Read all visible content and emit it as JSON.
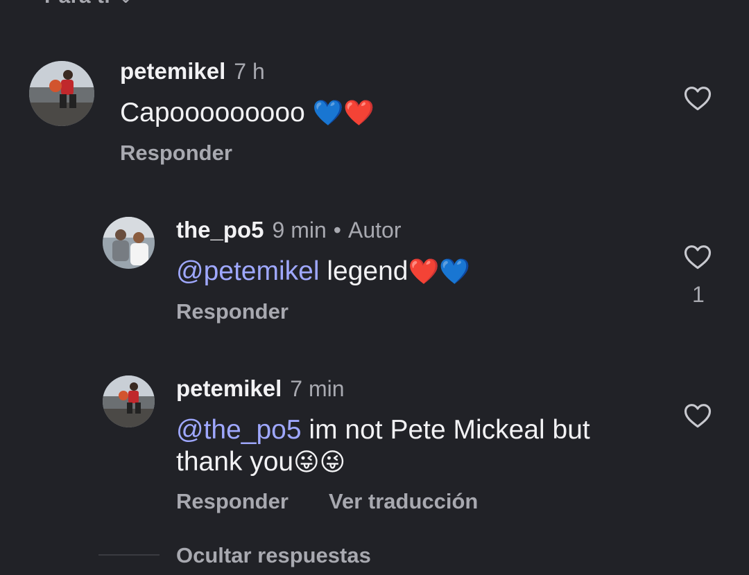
{
  "top_filter": {
    "label": "Para ti",
    "chevron_icon": "chevron-down-icon"
  },
  "comments": [
    {
      "username": "petemikel",
      "time": "7 h",
      "text": "Capooooooooo",
      "emojis": "💙❤️",
      "reply_label": "Responder",
      "like_icon": "heart-outline-icon"
    },
    {
      "username": "the_po5",
      "time": "9 min",
      "author_badge": "Autor",
      "mention": "@petemikel",
      "text": "legend",
      "emojis": "❤️💙",
      "reply_label": "Responder",
      "like_icon": "heart-outline-icon",
      "like_count": "1"
    },
    {
      "username": "petemikel",
      "time": "7 min",
      "mention": "@the_po5",
      "text_line1": "im not Pete Mickeal but",
      "text_line2": "thank you",
      "emojis": "😜😜",
      "reply_label": "Responder",
      "translate_label": "Ver traducción",
      "like_icon": "heart-outline-icon"
    }
  ],
  "hide_replies_label": "Ocultar respuestas",
  "colors": {
    "background": "#212227",
    "text_primary": "#f2f2f4",
    "text_secondary": "#a8a9b0",
    "mention": "#9fa8ff"
  }
}
